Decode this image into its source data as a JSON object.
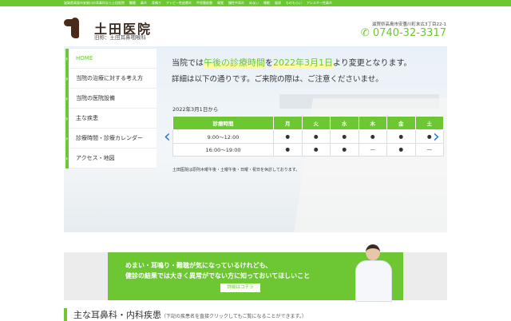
{
  "topbar": {
    "items": [
      "滋賀県高島市安曇川の耳鼻科なら土田医院",
      "難聴",
      "鼻炎",
      "耳鳴り",
      "アトピー性皮膚炎",
      "甲状腺疾患",
      "嗅覚",
      "慢性中耳炎",
      "めまい",
      "睡眠",
      "風邪",
      "ものもらい",
      "アレルギー性鼻炎"
    ]
  },
  "header": {
    "clinic_name": "土田医院",
    "former_name": "旧称：土田耳鼻咽喉科",
    "address": "滋賀県高島市安曇川町末広3丁目22-1",
    "phone": "0740-32-3317"
  },
  "nav": [
    {
      "label": "HOME"
    },
    {
      "label": "当院の治療に対する考え方"
    },
    {
      "label": "当院の医院設備"
    },
    {
      "label": "主な疾患"
    },
    {
      "label": "診療時間・診療カレンダー"
    },
    {
      "label": "アクセス・地図"
    }
  ],
  "notice": {
    "pre": "当院では",
    "hl1": "午後の診療時間",
    "mid": "を",
    "hl2": "2022年3月1日",
    "post": "より変更となります。",
    "line2": "詳細は以下の通りです。ご来院の際は、ご注意くださいませ。",
    "from": "2022年3月1日から",
    "note": "土田医院は原則木曜午後・土曜午後・日曜・祝日を休診しております。"
  },
  "schedule": {
    "headers": [
      "診療時間",
      "月",
      "火",
      "水",
      "木",
      "金",
      "土"
    ],
    "rows": [
      [
        "9:00〜12:00",
        "●",
        "●",
        "●",
        "●",
        "●",
        "●"
      ],
      [
        "16:00〜19:00",
        "●",
        "●",
        "●",
        "—",
        "●",
        "—"
      ]
    ]
  },
  "banner": {
    "line1": "めまい・耳鳴り・難聴が気になっているけれども、",
    "line2": "健診の結果では大きく異常がでない方に知っておいてほしいこと",
    "button": "詳細はコチラ"
  },
  "section": {
    "title": "主な耳鼻科・内科疾患",
    "subtitle": "（下記の疾患名を直接クリックしてもご覧になることができます。）"
  },
  "colors": {
    "accent": "#6cc733",
    "arrow": "#2a7bd0"
  }
}
